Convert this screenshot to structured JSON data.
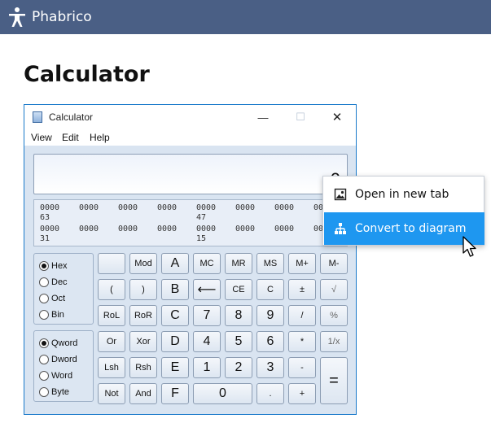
{
  "app": {
    "brand": "Phabrico"
  },
  "page": {
    "title": "Calculator"
  },
  "calculator": {
    "title": "Calculator",
    "window_controls": {
      "minimize": "—",
      "maximize": "☐",
      "close": "✕"
    },
    "menu": [
      "View",
      "Edit",
      "Help"
    ],
    "display": "0",
    "bits": {
      "row1": [
        "0000",
        "0000",
        "0000",
        "0000",
        "0000",
        "0000",
        "0000",
        "00"
      ],
      "row1_positions": [
        "63",
        "47"
      ],
      "row2": [
        "0000",
        "0000",
        "0000",
        "0000",
        "0000",
        "0000",
        "0000",
        "00"
      ],
      "row2_positions": [
        "31",
        "15"
      ]
    },
    "bases": [
      {
        "label": "Hex",
        "selected": true
      },
      {
        "label": "Dec",
        "selected": false
      },
      {
        "label": "Oct",
        "selected": false
      },
      {
        "label": "Bin",
        "selected": false
      }
    ],
    "word_sizes": [
      {
        "label": "Qword",
        "selected": true
      },
      {
        "label": "Dword",
        "selected": false
      },
      {
        "label": "Word",
        "selected": false
      },
      {
        "label": "Byte",
        "selected": false
      }
    ],
    "keys": {
      "row1": [
        "",
        "Mod",
        "A",
        "MC",
        "MR",
        "MS",
        "M+",
        "M-"
      ],
      "row2": [
        "(",
        ")",
        "B",
        "⟵",
        "CE",
        "C",
        "±",
        "√"
      ],
      "row3": [
        "RoL",
        "RoR",
        "C",
        "7",
        "8",
        "9",
        "/",
        "%"
      ],
      "row4": [
        "Or",
        "Xor",
        "D",
        "4",
        "5",
        "6",
        "*",
        "1/x"
      ],
      "row5": [
        "Lsh",
        "Rsh",
        "E",
        "1",
        "2",
        "3",
        "-"
      ],
      "row6": [
        "Not",
        "And",
        "F",
        "0",
        ".",
        "+"
      ],
      "equals": "="
    }
  },
  "context_menu": {
    "items": [
      {
        "label": "Open in new tab",
        "icon": "image-icon"
      },
      {
        "label": "Convert to diagram",
        "icon": "diagram-icon",
        "highlighted": true
      }
    ]
  }
}
